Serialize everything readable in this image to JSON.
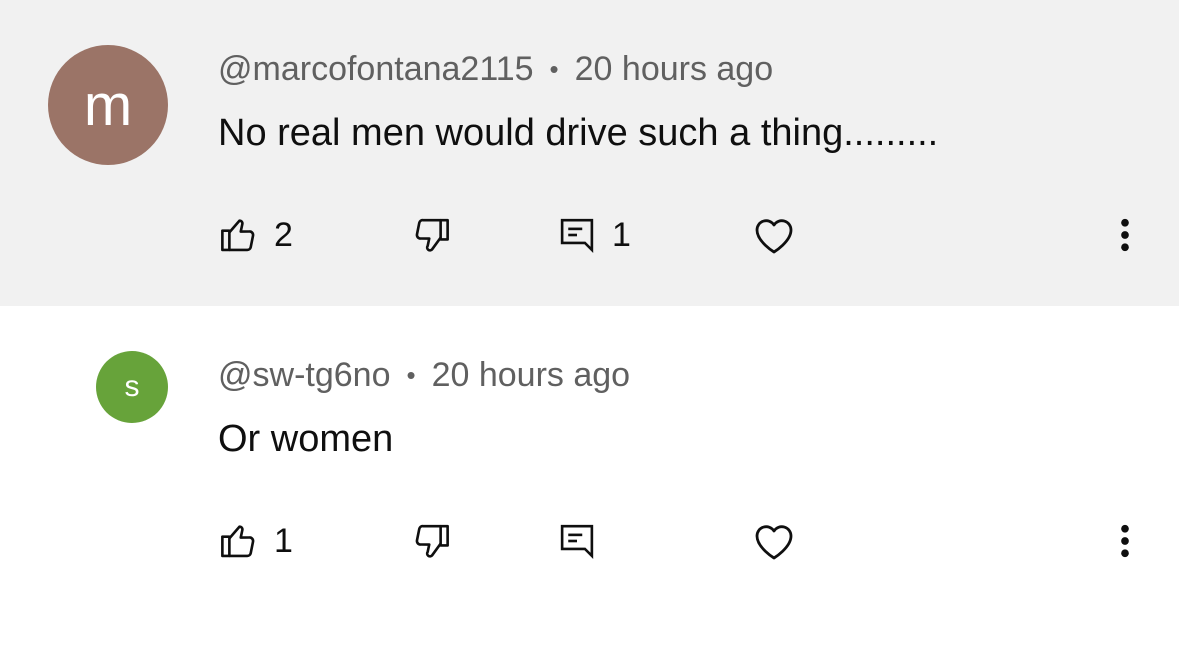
{
  "comments": [
    {
      "avatar_letter": "m",
      "avatar_color": "#9b7467",
      "handle": "@marcofontana2115",
      "separator": "•",
      "time": "20 hours ago",
      "text": "No real men would drive such a thing.........",
      "likes": "2",
      "replies": "1",
      "background": "#f1f1f1"
    },
    {
      "avatar_letter": "s",
      "avatar_color": "#67a33a",
      "handle": "@sw-tg6no",
      "separator": "•",
      "time": "20 hours ago",
      "text": "Or women",
      "likes": "1",
      "replies": "",
      "background": "#ffffff"
    }
  ],
  "icons": [
    "thumbs-up-icon",
    "thumbs-down-icon",
    "reply-icon",
    "heart-icon",
    "more-vert-icon"
  ]
}
